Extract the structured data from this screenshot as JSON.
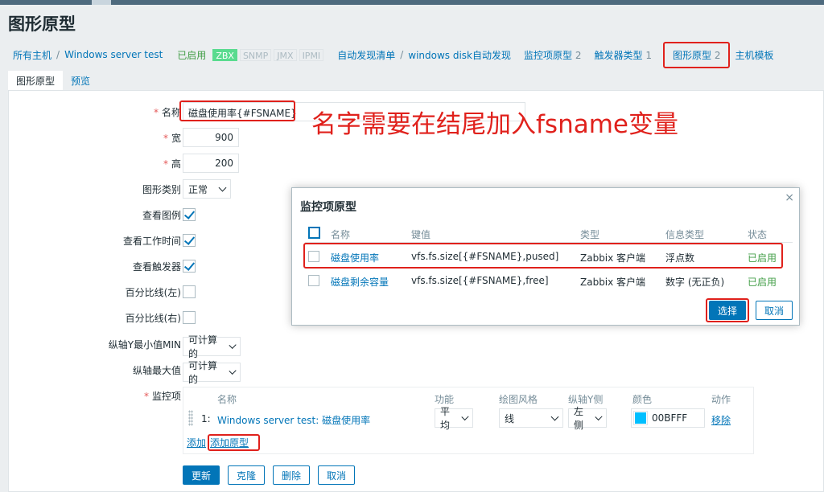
{
  "page": {
    "title": "图形原型"
  },
  "breadcrumbs": {
    "all_hosts": "所有主机",
    "sep": "/",
    "host": "Windows server test",
    "status": "已启用",
    "badges": [
      "ZBX",
      "SNMP",
      "JMX",
      "IPMI"
    ],
    "discovery_list": "自动发现清单",
    "discovery_rule": "windows disk自动发现",
    "item_prototypes": "监控项原型",
    "item_prototypes_count": "2",
    "trigger_types": "触发器类型",
    "trigger_types_count": "1",
    "graph_prototypes": "图形原型",
    "graph_prototypes_count": "2",
    "host_template": "主机模板"
  },
  "tabs": [
    {
      "label": "图形原型"
    },
    {
      "label": "预览"
    }
  ],
  "form": {
    "name_label": "名称",
    "name_value": "磁盘使用率{#FSNAME}",
    "width_label": "宽",
    "width_value": "900",
    "height_label": "高",
    "height_value": "200",
    "graph_type_label": "图形类别",
    "graph_type_value": "正常",
    "show_legend_label": "查看图例",
    "show_working_time_label": "查看工作时间",
    "show_triggers_label": "查看触发器",
    "percentile_left_label": "百分比线(左)",
    "percentile_right_label": "百分比线(右)",
    "ymin_label": "纵轴Y最小值MIN",
    "ymin_value": "可计算的",
    "ymax_label": "纵轴最大值",
    "ymax_value": "可计算的",
    "items_label": "监控项",
    "items_columns": [
      "名称",
      "功能",
      "绘图风格",
      "纵轴Y侧",
      "颜色",
      "动作"
    ],
    "items": [
      {
        "index": "1:",
        "name": "Windows server test: 磁盘使用率",
        "function": "平均",
        "style": "线",
        "y_side": "左侧",
        "color": "00BFFF",
        "action": "移除"
      }
    ],
    "add_link": "添加",
    "add_prototype_link": "添加原型",
    "buttons": {
      "update": "更新",
      "clone": "克隆",
      "delete": "删除",
      "cancel": "取消"
    }
  },
  "annotation": "名字需要在结尾加入fsname变量",
  "modal": {
    "title": "监控项原型",
    "close": "×",
    "columns": [
      "名称",
      "键值",
      "类型",
      "信息类型",
      "状态"
    ],
    "rows": [
      {
        "name": "磁盘使用率",
        "key": "vfs.fs.size[{#FSNAME},pused]",
        "type": "Zabbix 客户端",
        "info_type": "浮点数",
        "status": "已启用"
      },
      {
        "name": "磁盘剩余容量",
        "key": "vfs.fs.size[{#FSNAME},free]",
        "type": "Zabbix 客户端",
        "info_type": "数字 (无正负)",
        "status": "已启用"
      }
    ],
    "select_button": "选择",
    "cancel_button": "取消"
  },
  "colors": {
    "link": "#0275b8",
    "enabled": "#429e47",
    "highlight": "#e0211c",
    "item_color": "#00BFFF"
  }
}
